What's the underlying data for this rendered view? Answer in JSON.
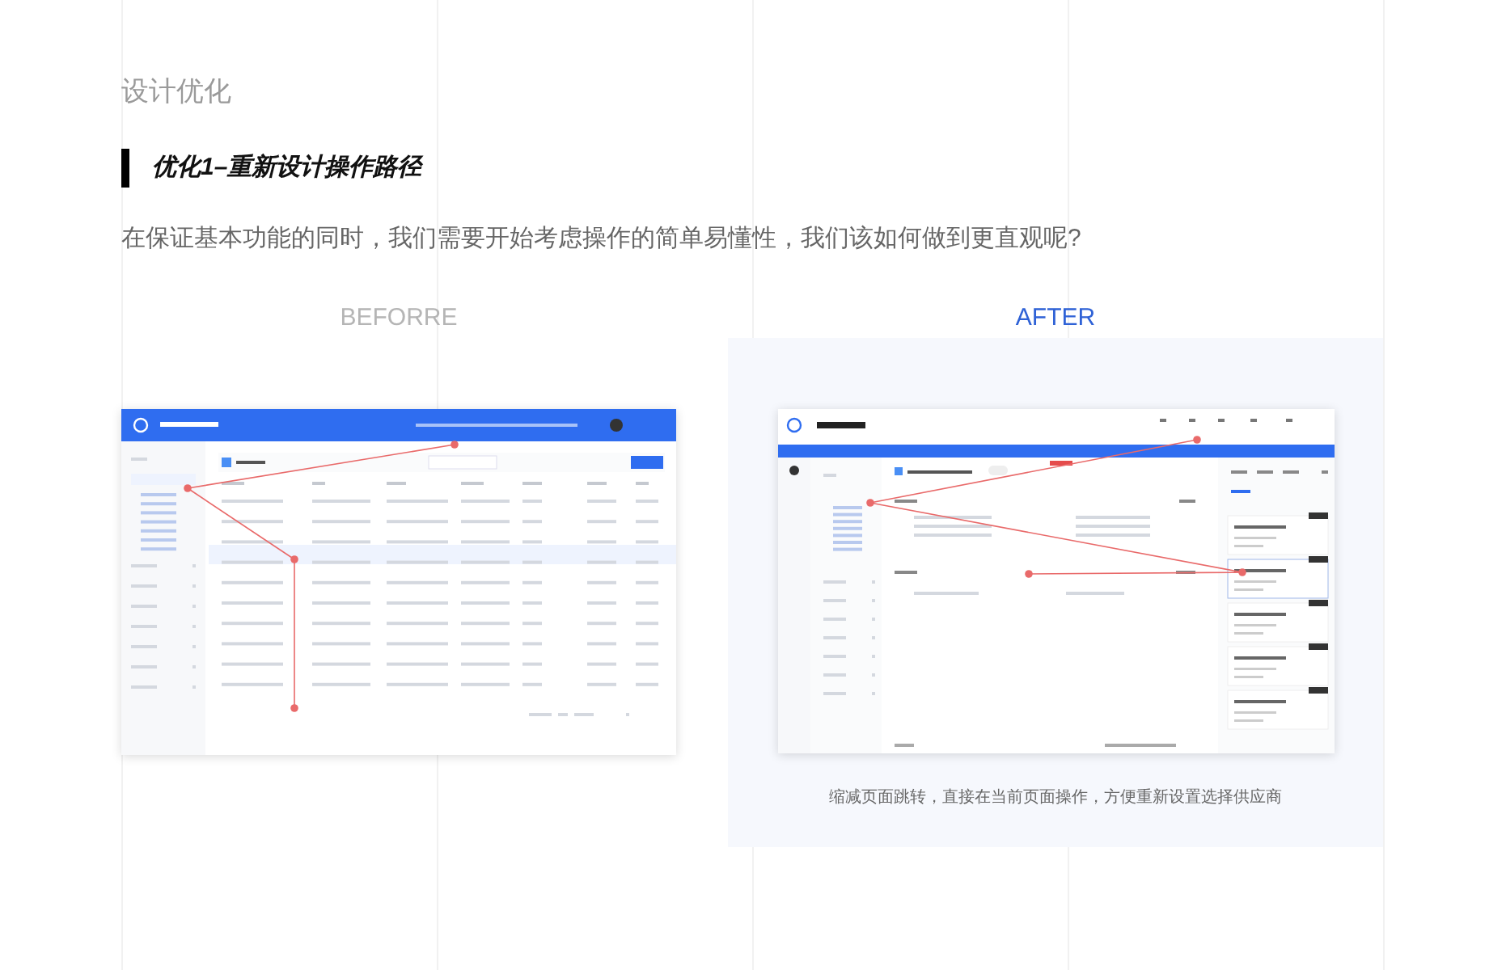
{
  "section_title": "设计优化",
  "heading": "优化1–重新设计操作路径",
  "intro": "在保证基本功能的同时，我们需要开始考虑操作的简单易懂性，我们该如何做到更直观呢?",
  "before": {
    "label": "BEFORRE"
  },
  "after": {
    "label": "AFTER",
    "caption": "缩减页面跳转，直接在当前页面操作，方便重新设置选择供应商"
  }
}
